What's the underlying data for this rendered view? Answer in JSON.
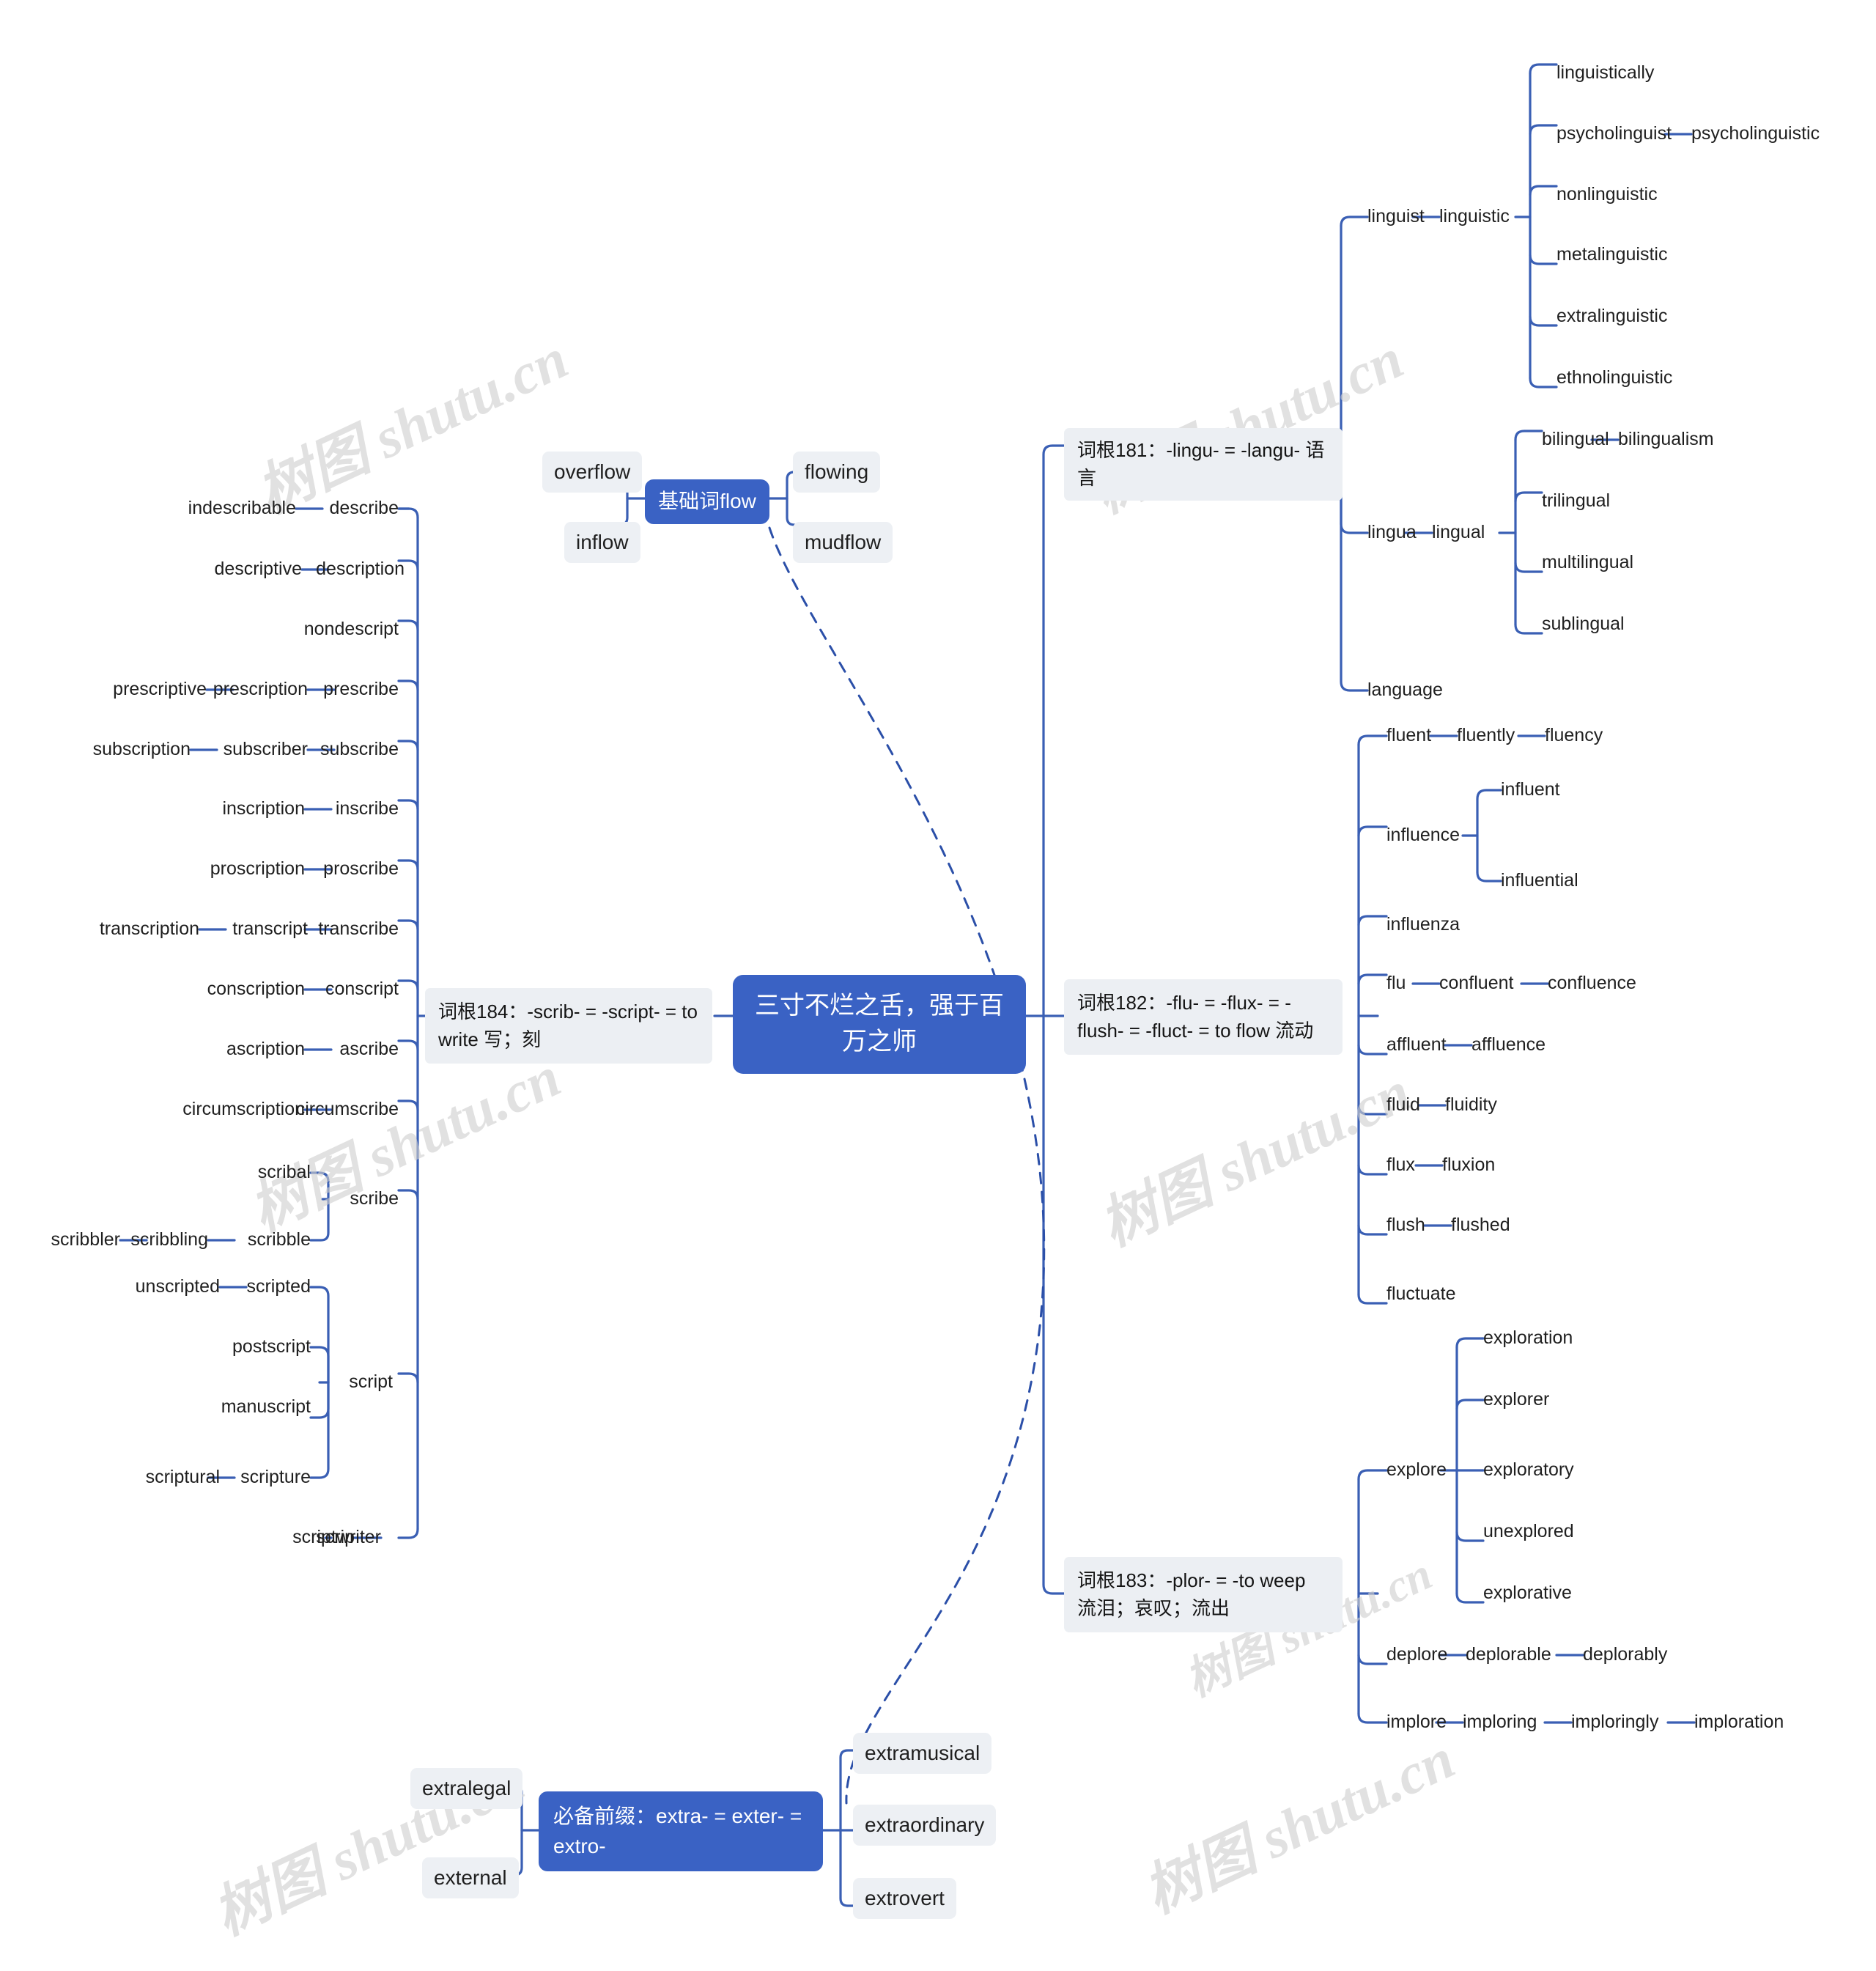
{
  "meta": {
    "watermark_text": "树图 shutu.cn",
    "accent_blue": "#3a62c4",
    "link_color": "#3a5fb4",
    "chip_bg": "#edf0f4",
    "page_bg": "#ffffff"
  },
  "center": {
    "title": "三寸不烂之舌，强于百万之师"
  },
  "basic_word": {
    "label": "基础词flow",
    "left_children": [
      "overflow",
      "inflow"
    ],
    "right_children": [
      "flowing",
      "mudflow"
    ]
  },
  "prefix": {
    "label": "必备前缀：extra- = exter- = extro-",
    "left_children": [
      "extralegal",
      "external"
    ],
    "right_children": [
      "extramusical",
      "extraordinary",
      "extrovert"
    ]
  },
  "branches": {
    "b184": {
      "label": "词根184：-scrib- = -script- =  to write 写；刻",
      "rows": [
        [
          "indescribable",
          "describe"
        ],
        [
          "descriptive",
          "description"
        ],
        [
          "nondescript"
        ],
        [
          "prescriptive",
          "prescription",
          "prescribe"
        ],
        [
          "subscription",
          "subscriber",
          "subscribe"
        ],
        [
          "inscription",
          "inscribe"
        ],
        [
          "proscription",
          "proscribe"
        ],
        [
          "transcription",
          "transcript",
          "transcribe"
        ],
        [
          "conscription",
          "conscript"
        ],
        [
          "ascription",
          "ascribe"
        ],
        [
          "circumscription",
          "circumscribe"
        ]
      ],
      "scribe_group": {
        "parent": "scribe",
        "children": [
          "scribal",
          "scribble"
        ],
        "scribble_chain": [
          "scribbler",
          "scribbling"
        ]
      },
      "script_group": {
        "parent": "script",
        "children": [
          "scripted",
          "postscript",
          "manuscript",
          "scripture"
        ],
        "scripted_chain": [
          "unscripted"
        ],
        "scripture_chain": [
          "scriptural"
        ]
      },
      "scrip_row": [
        "scriptwriter",
        "scrip"
      ]
    },
    "b181": {
      "label": "词根181：-lingu- = -langu- 语言",
      "linguist_chain": [
        "linguist",
        "linguistic"
      ],
      "linguistic_children": [
        "linguistically",
        "psycholinguist",
        "nonlinguistic",
        "metalinguistic",
        "extralinguistic",
        "ethnolinguistic"
      ],
      "psycholinguist_child": "psycholinguistic",
      "lingua_chain": [
        "lingua",
        "lingual"
      ],
      "lingual_children": [
        "bilingual",
        "trilingual",
        "multilingual",
        "sublingual"
      ],
      "bilingual_child": "bilingualism",
      "language": "language"
    },
    "b182": {
      "label": "词根182：-flu- = -flux- = -flush- = -fluct- = to flow 流动",
      "rows": [
        [
          "fluent",
          "fluently",
          "fluency"
        ],
        [
          "influence"
        ],
        [
          "influenza"
        ],
        [
          "flu",
          "confluent",
          "confluence"
        ],
        [
          "affluent",
          "affluence"
        ],
        [
          "fluid",
          "fluidity"
        ],
        [
          "flux",
          "fluxion"
        ],
        [
          "flush",
          "flushed"
        ],
        [
          "fluctuate"
        ]
      ],
      "influence_children": [
        "influent",
        "influential"
      ]
    },
    "b183": {
      "label": "词根183：-plor- = -to weep 流泪；哀叹；流出",
      "explore": "explore",
      "explore_children": [
        "exploration",
        "explorer",
        "exploratory",
        "unexplored",
        "explorative"
      ],
      "deplore_row": [
        "deplore",
        "deplorable",
        "deplorably"
      ],
      "implore_row": [
        "implore",
        "imploring",
        "imploringly",
        "imploration"
      ]
    }
  }
}
